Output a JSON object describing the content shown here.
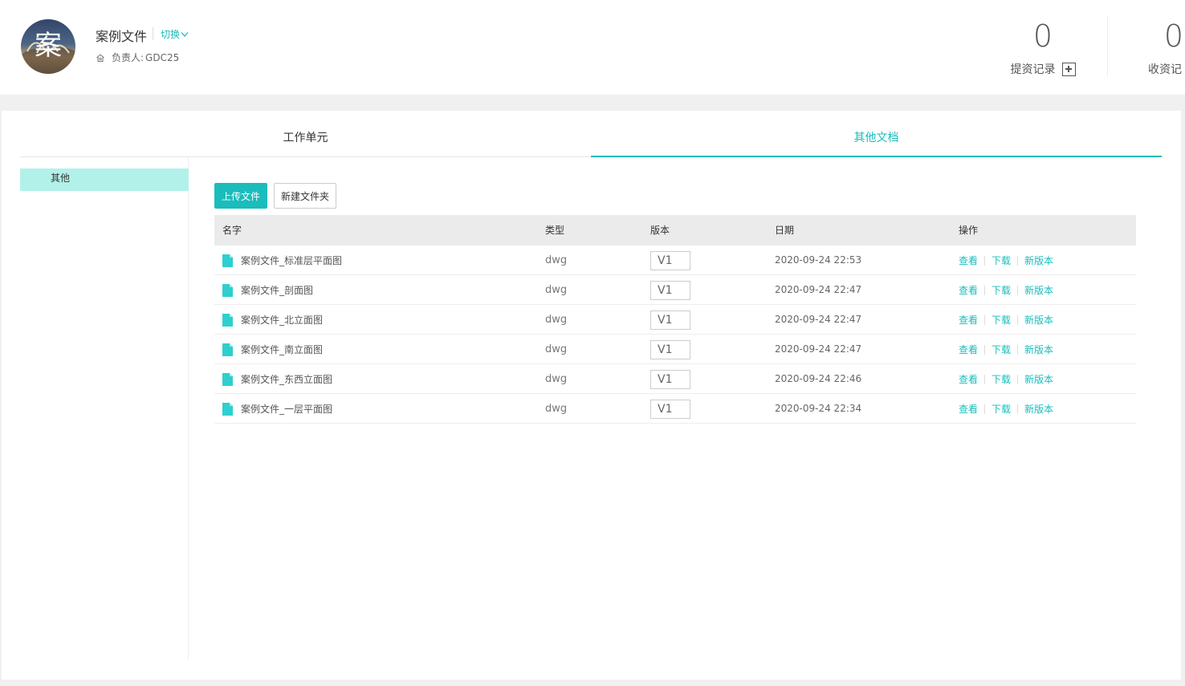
{
  "header": {
    "avatar_char": "案",
    "project_name": "案例文件",
    "switch_label": "切换",
    "owner_label": "负责人:",
    "owner_value": "GDC25",
    "stats": [
      {
        "value": "0",
        "label": "提资记录"
      },
      {
        "value": "0",
        "label": "收资记"
      }
    ]
  },
  "tabs": [
    {
      "label": "工作单元",
      "active": false
    },
    {
      "label": "其他文档",
      "active": true
    }
  ],
  "sidebar": {
    "items": [
      {
        "label": "其他",
        "selected": true
      }
    ]
  },
  "toolbar": {
    "upload_label": "上传文件",
    "new_folder_label": "新建文件夹"
  },
  "table": {
    "columns": [
      "名字",
      "类型",
      "版本",
      "日期",
      "操作"
    ],
    "actions": [
      "查看",
      "下载",
      "新版本"
    ],
    "rows": [
      {
        "name": "案例文件_标准层平面图",
        "type": "dwg",
        "version": "V1",
        "date": "2020-09-24 22:53"
      },
      {
        "name": "案例文件_剖面图",
        "type": "dwg",
        "version": "V1",
        "date": "2020-09-24 22:47"
      },
      {
        "name": "案例文件_北立面图",
        "type": "dwg",
        "version": "V1",
        "date": "2020-09-24 22:47"
      },
      {
        "name": "案例文件_南立面图",
        "type": "dwg",
        "version": "V1",
        "date": "2020-09-24 22:47"
      },
      {
        "name": "案例文件_东西立面图",
        "type": "dwg",
        "version": "V1",
        "date": "2020-09-24 22:46"
      },
      {
        "name": "案例文件_一层平面图",
        "type": "dwg",
        "version": "V1",
        "date": "2020-09-24 22:34"
      }
    ]
  },
  "colors": {
    "accent": "#1bbcbc",
    "sidebar_selected": "#b2f1ea",
    "table_header": "#ebebeb"
  },
  "icons": {
    "file": "file-icon",
    "owner": "home-icon",
    "switch": "chevron-down-icon",
    "add": "plus-box-icon"
  }
}
